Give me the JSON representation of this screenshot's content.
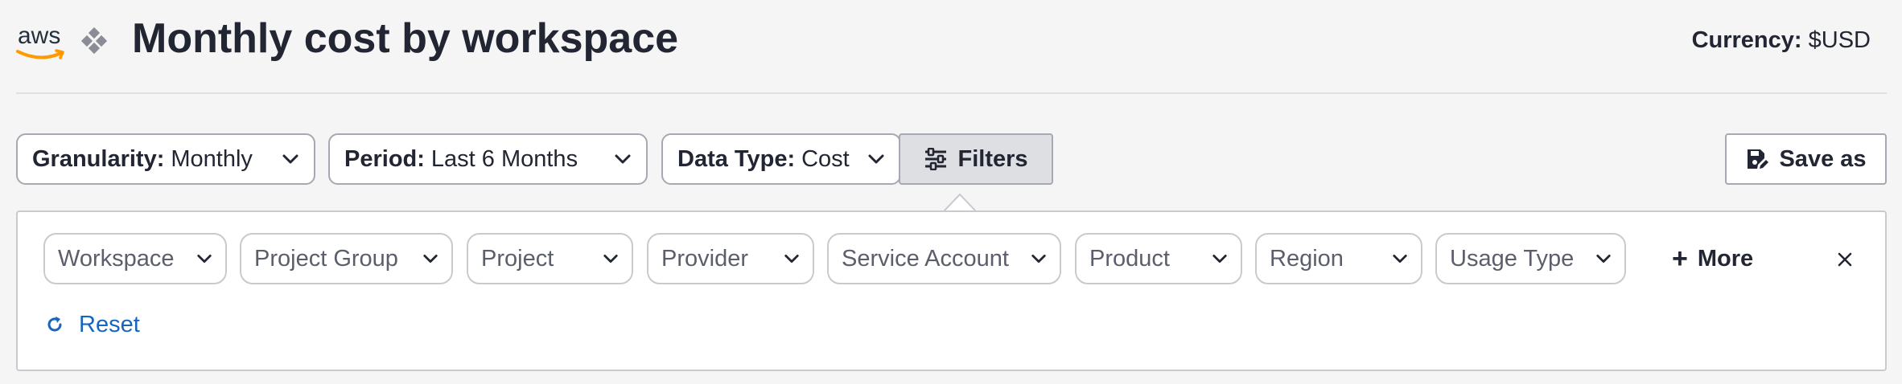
{
  "header": {
    "logo_text": "aws",
    "title": "Monthly cost by workspace",
    "currency_label": "Currency:",
    "currency_value": "$USD"
  },
  "toolbar": {
    "granularity": {
      "label": "Granularity:",
      "value": "Monthly"
    },
    "period": {
      "label": "Period:",
      "value": "Last 6 Months"
    },
    "data_type": {
      "label": "Data Type:",
      "value": "Cost"
    },
    "filters_label": "Filters",
    "save_as_label": "Save as"
  },
  "filter_panel": {
    "chips": [
      "Workspace",
      "Project Group",
      "Project",
      "Provider",
      "Service Account",
      "Product",
      "Region",
      "Usage Type"
    ],
    "more_label": "More",
    "reset_label": "Reset"
  },
  "colors": {
    "background": "#f5f5f5",
    "text": "#222532",
    "border": "#a6a8b2",
    "filters_active_bg": "#dedfe3",
    "link": "#1665c0",
    "aws_orange": "#ff9900"
  },
  "icons": {
    "provider": "diamond-cluster-icon",
    "dropdown": "chevron-down-icon",
    "filters": "sliders-icon",
    "save": "save-edit-icon",
    "more": "plus-icon",
    "close": "close-icon",
    "reset": "refresh-icon"
  }
}
